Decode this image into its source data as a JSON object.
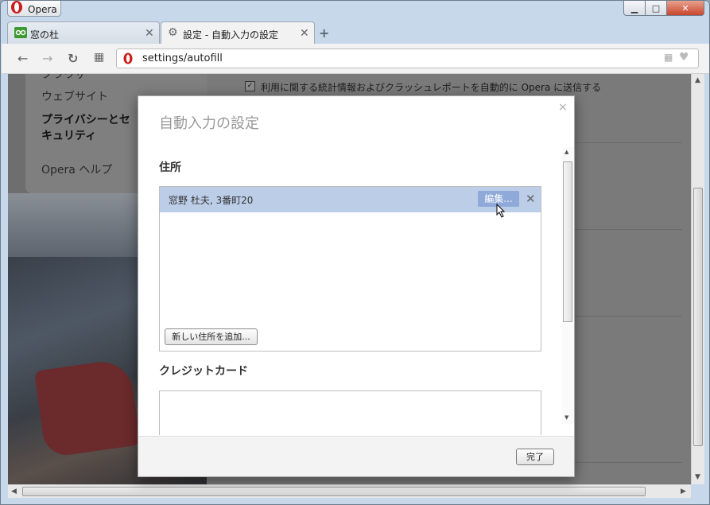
{
  "app": {
    "title": "Opera"
  },
  "window_controls": {
    "minimize": "▁",
    "maximize": "□",
    "close": "✕"
  },
  "tabs": [
    {
      "label": "窓の杜",
      "icon": "site-favicon-icon"
    },
    {
      "label": "設定 - 自動入力の設定",
      "icon": "gear-icon"
    }
  ],
  "new_tab_label": "+",
  "toolbar": {
    "back": "←",
    "forward": "→",
    "reload": "↻",
    "speed_dial": "▦",
    "url": "settings/autofill"
  },
  "sidebar": {
    "items": [
      "ブラウザ",
      "ウェブサイト",
      "プライバシーとセキュリティ",
      "Opera ヘルプ"
    ]
  },
  "settings_page": {
    "stats_checkbox_label": "利用に関する統計情報およびクラッシュレポートを自動的に Opera に送信する",
    "stats_checked": "✓"
  },
  "dialog": {
    "title": "自動入力の設定",
    "close": "×",
    "address_section_title": "住所",
    "addresses": [
      {
        "text": "窓野 杜夫, 3番町20",
        "edit_label": "編集...",
        "remove_label": "✕"
      }
    ],
    "add_address_button": "新しい住所を追加...",
    "credit_card_section_title": "クレジットカード",
    "done_button": "完了"
  },
  "colors": {
    "accent_selection": "#bccde8",
    "edit_button": "#8fa9d8",
    "opera_red": "#cc1b1b"
  }
}
